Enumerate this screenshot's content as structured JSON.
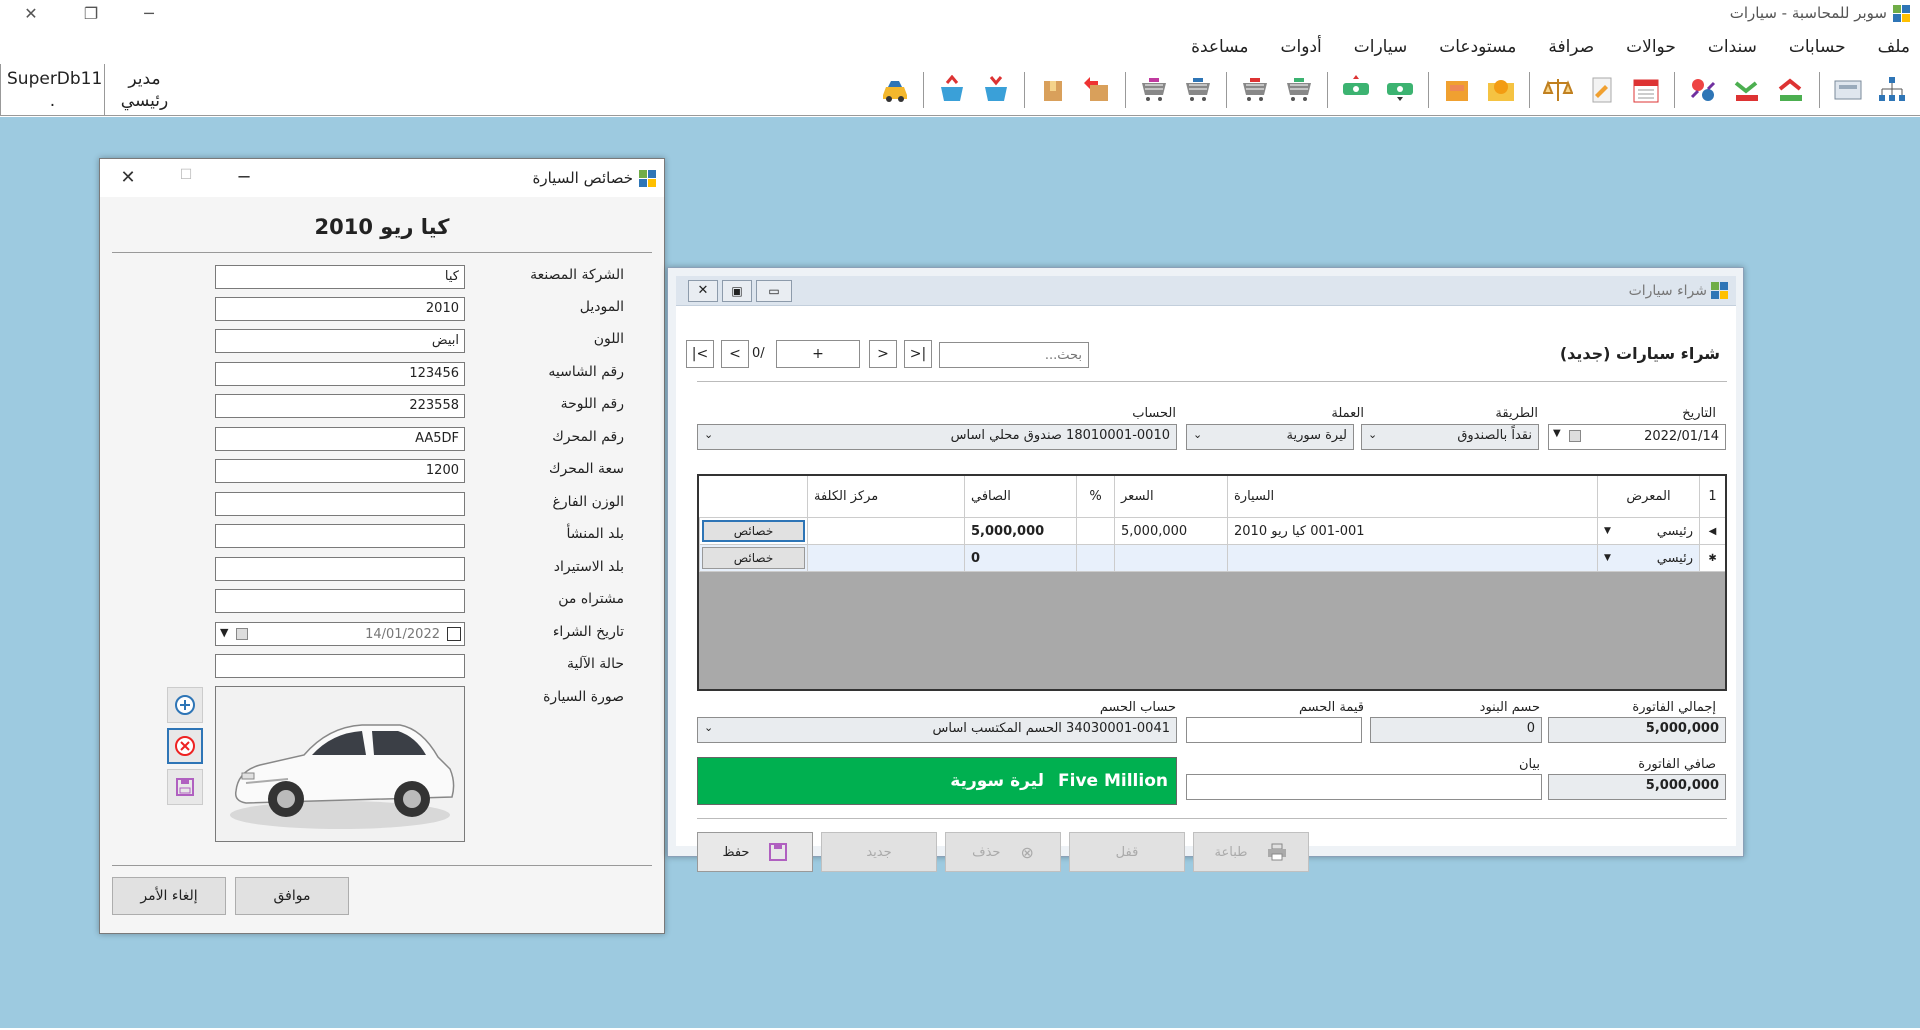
{
  "app": {
    "title": "سوبر للمحاسبة - سيارات",
    "menu": [
      "ملف",
      "حسابات",
      "سندات",
      "حوالات",
      "صرافة",
      "مستودعات",
      "سيارات",
      "أدوات",
      "مساعدة"
    ]
  },
  "user": {
    "db": "SuperDb11",
    "dot": ".",
    "role_line1": "مدير",
    "role_line2": "رئيسي"
  },
  "toolbar_icons": [
    "tree-icon",
    "register-icon",
    "receipt-down-icon",
    "receipt-up-icon",
    "exchange-icon",
    "calendar-icon",
    "edit-doc-icon",
    "scale-icon",
    "money-envelope-icon",
    "money-box-icon",
    "cash-green-icon",
    "cash-red-icon",
    "cart-green-icon",
    "cart-red-icon",
    "cart-blue-icon",
    "cart-purple-icon",
    "box-transfer-icon",
    "box-icon",
    "basket-out-icon",
    "basket-in-icon",
    "car-icon"
  ],
  "car_window": {
    "title": "خصائص السيارة",
    "heading": "كيا ريو 2010",
    "fields": [
      {
        "label": "الشركة المصنعة",
        "value": "كيا"
      },
      {
        "label": "الموديل",
        "value": "2010"
      },
      {
        "label": "اللون",
        "value": "ابيض"
      },
      {
        "label": "رقم الشاسيه",
        "value": "123456"
      },
      {
        "label": "رقم اللوحة",
        "value": "223558"
      },
      {
        "label": "رقم المحرك",
        "value": "AA5DF"
      },
      {
        "label": "سعة المحرك",
        "value": "1200"
      },
      {
        "label": "الوزن الفارغ",
        "value": ""
      },
      {
        "label": "بلد المنشأ",
        "value": ""
      },
      {
        "label": "بلد الاستيراد",
        "value": ""
      },
      {
        "label": "مشتراه من",
        "value": ""
      }
    ],
    "purchase_date_label": "تاريخ الشراء",
    "purchase_date": "14/01/2022",
    "status_label": "حالة الآلية",
    "image_label": "صورة السيارة",
    "ok": "موافق",
    "cancel": "إلغاء الأمر"
  },
  "purchase_window": {
    "title": "شراء سيارات",
    "heading": "شراء سيارات (جديد)",
    "search_placeholder": "بحث...",
    "nav_counter": "0/",
    "nav_new": "+",
    "date_label": "التاريخ",
    "date": "2022/01/14",
    "method_label": "الطريقة",
    "method": "نقداً بالصندوق",
    "currency_label": "العملة",
    "currency": "ليرة سورية",
    "account_label": "الحساب",
    "account": "18010001-0010 صندوق محلي اساس",
    "grid": {
      "row_num_header": "1",
      "headers": [
        "المعرض",
        "السيارة",
        "السعر",
        "%",
        "الصافي",
        "مركز الكلفة"
      ],
      "rows": [
        {
          "showroom": "رئيسي",
          "car": "001-001 كيا ريو 2010",
          "price": "5,000,000",
          "pct": "",
          "net": "5,000,000",
          "cost_center": "",
          "btn": "خصائص"
        },
        {
          "showroom": "رئيسي",
          "car": "",
          "price": "",
          "pct": "",
          "net": "0",
          "cost_center": "",
          "btn": "خصائص"
        }
      ]
    },
    "total_label": "إجمالي الفاتورة",
    "total": "5,000,000",
    "items_discount_label": "حسم البنود",
    "items_discount": "0",
    "discount_value_label": "قيمة الحسم",
    "discount_value": "",
    "discount_account_label": "حساب الحسم",
    "discount_account": "34030001-0041 الحسم المكتسب اساس",
    "net_label": "صافي الفاتورة",
    "net": "5,000,000",
    "statement_label": "بيان",
    "statement": "",
    "amount_words_en": "Five Million",
    "amount_words_ar": "ليرة سورية",
    "buttons": {
      "save": "حفظ",
      "new": "جديد",
      "delete": "حذف",
      "lock": "قفل",
      "print": "طباعة"
    }
  }
}
